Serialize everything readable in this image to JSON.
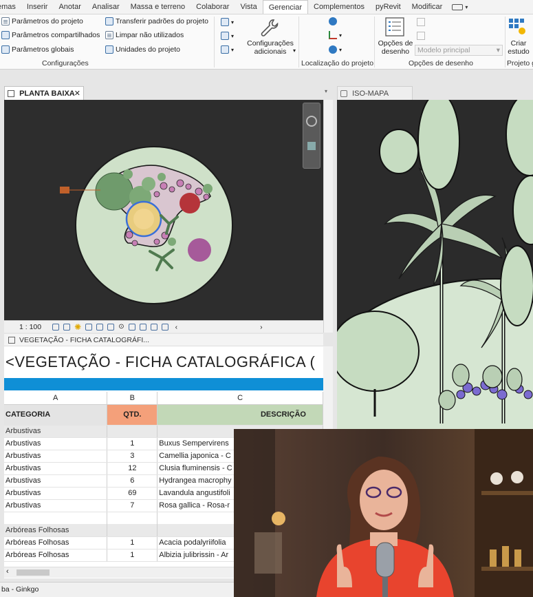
{
  "ribbon_tabs": [
    "emas",
    "Inserir",
    "Anotar",
    "Analisar",
    "Massa e terreno",
    "Colaborar",
    "Vista",
    "Gerenciar",
    "Complementos",
    "pyRevit",
    "Modificar"
  ],
  "active_tab": "Gerenciar",
  "configuracoes": {
    "items_left": [
      "Parâmetros do projeto",
      "Parâmetros compartilhados",
      "Parâmetros globais"
    ],
    "items_right": [
      "Transferir padrões do projeto",
      "Limpar não utilizados",
      "Unidades do projeto"
    ],
    "label": "Configurações"
  },
  "config_adicionais": "Configurações adicionais",
  "localizacao": "Localização do projeto",
  "opcoes_desenho": {
    "button": "Opções de desenho",
    "dropdown": "Modelo principal",
    "label": "Opções de desenho"
  },
  "criar_estudo": "Criar estudo",
  "projeto_g": "Projeto g",
  "views": {
    "plan_tab": "PLANTA BAIXA",
    "iso_tab": "ISO-MAPA",
    "scale": "1 : 100"
  },
  "schedule": {
    "tab": "VEGETAÇÃO - FICHA CATALOGRÁFI...",
    "title": "<VEGETAÇÃO - FICHA CATALOGRÁFICA (",
    "col_letters": [
      "A",
      "B",
      "C"
    ],
    "headers": [
      "CATEGORIA",
      "QTD.",
      "DESCRIÇÃO"
    ],
    "groups": [
      {
        "name": "Arbustivas",
        "rows": [
          [
            "Arbustivas",
            "1",
            "Buxus Sempervirens"
          ],
          [
            "Arbustivas",
            "3",
            "Camellia japonica - C"
          ],
          [
            "Arbustivas",
            "12",
            "Clusia fluminensis - C"
          ],
          [
            "Arbustivas",
            "6",
            "Hydrangea macrophy"
          ],
          [
            "Arbustivas",
            "69",
            "Lavandula angustifoli"
          ],
          [
            "Arbustivas",
            "7",
            "Rosa gallica - Rosa-r"
          ]
        ]
      },
      {
        "name": "Arbóreas Folhosas",
        "rows": [
          [
            "Arbóreas Folhosas",
            "1",
            "Acacia podalyriifolia"
          ],
          [
            "Arbóreas Folhosas",
            "1",
            "Albizia julibrissin - Ar"
          ]
        ]
      }
    ]
  },
  "status_bottom": "ba - Ginkgo",
  "colors": {
    "schedule_bar": "#0f8fd6",
    "qtd_header": "#f4a07a",
    "desc_header": "#c2d8b7",
    "active_tab_bg": "#ffffff"
  }
}
